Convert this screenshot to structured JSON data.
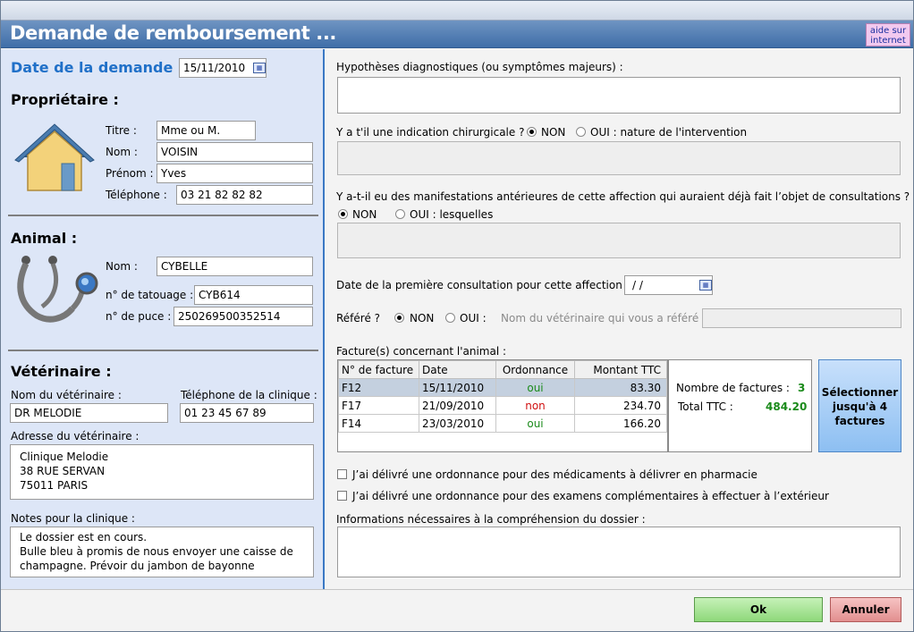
{
  "window": {
    "title": "Demande de remboursement ...",
    "help_label": "aide sur internet",
    "colors": {
      "accent": "#3f6ea8",
      "date_label": "#2070c8",
      "ok": "#8ed87a",
      "cancel": "#e28f8f",
      "select": "#8dbff2"
    }
  },
  "left": {
    "date_label": "Date de la demande :",
    "date_value": "15/11/2010",
    "owner": {
      "heading": "Propriétaire :",
      "icon": "house-icon",
      "title_label": "Titre :",
      "title_value": "Mme ou M.",
      "lastname_label": "Nom :",
      "lastname_value": "VOISIN",
      "firstname_label": "Prénom :",
      "firstname_value": "Yves",
      "phone_label": "Téléphone :",
      "phone_value": "03 21 82 82 82"
    },
    "animal": {
      "heading": "Animal :",
      "icon": "stethoscope-icon",
      "name_label": "Nom :",
      "name_value": "CYBELLE",
      "tattoo_label": "n° de tatouage :",
      "tattoo_value": "CYB614",
      "chip_label": "n° de puce :",
      "chip_value": "250269500352514"
    },
    "vet": {
      "heading": "Vétérinaire :",
      "name_label": "Nom du vétérinaire :",
      "name_value": "DR MELODIE",
      "clinic_phone_label": "Téléphone de la clinique :",
      "clinic_phone_value": "01 23 45 67 89",
      "address_label": "Adresse du vétérinaire :",
      "address_value": "Clinique Melodie\n38 RUE SERVAN\n75011 PARIS",
      "notes_label": "Notes pour la clinique :",
      "notes_value": "Le dossier est en cours.\nBulle bleu à promis de nous envoyer une caisse de champagne. Prévoir du jambon de bayonne"
    }
  },
  "right": {
    "hypotheses_label": "Hypothèses diagnostiques (ou symptômes majeurs) :",
    "hypotheses_value": "",
    "surgery_label": "Y a t'il une indication chirurgicale ?",
    "surgery_no": "NON",
    "surgery_yes": "OUI : nature de l'intervention",
    "surgery_selected": "NON",
    "previous_label": "Y a-t-il eu des manifestations antérieures de cette affection qui auraient déjà fait l’objet de consultations ?",
    "previous_no": "NON",
    "previous_yes": "OUI : lesquelles",
    "previous_selected": "NON",
    "first_consult_label": "Date de la première consultation pour cette affection ?",
    "first_consult_value": "/ /",
    "referred_label": "Référé ?",
    "referred_no": "NON",
    "referred_yes": "OUI :",
    "referred_selected": "NON",
    "referrer_label": "Nom du vétérinaire qui vous a référé :",
    "referrer_value": "",
    "invoices_label": "Facture(s) concernant l'animal :",
    "invoice_columns": [
      "N° de facture",
      "Date",
      "Ordonnance",
      "Montant TTC"
    ],
    "invoices": [
      {
        "number": "F12",
        "date": "15/11/2010",
        "prescription": "oui",
        "amount": "83.30"
      },
      {
        "number": "F17",
        "date": "21/09/2010",
        "prescription": "non",
        "amount": "234.70"
      },
      {
        "number": "F14",
        "date": "23/03/2010",
        "prescription": "oui",
        "amount": "166.20"
      }
    ],
    "invoice_count_label": "Nombre de factures :",
    "invoice_count_value": "3",
    "total_label": "Total TTC :",
    "total_value": "484.20",
    "select_button": "Sélectionner jusqu'à 4 factures",
    "check_pharmacy": "J’ai délivré une ordonnance pour des médicaments à délivrer en pharmacie",
    "check_exams": "J’ai délivré une ordonnance pour des examens complémentaires à effectuer à l’extérieur",
    "info_label": "Informations nécessaires à la compréhension du dossier :",
    "info_value": ""
  },
  "footer": {
    "ok_label": "Ok",
    "cancel_label": "Annuler"
  }
}
